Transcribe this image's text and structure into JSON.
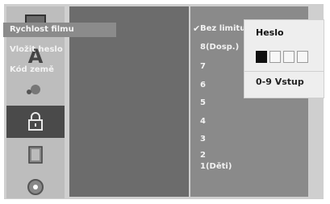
{
  "menu": {
    "items": [
      {
        "label": "Rychlost filmu",
        "selected": true
      },
      {
        "label": "Vložit heslo",
        "selected": false
      },
      {
        "label": "Kód země",
        "selected": false
      }
    ]
  },
  "options": {
    "items": [
      "Bez limitu",
      "8(Dosp.)",
      "7",
      "6",
      "5",
      "4",
      "3",
      "2",
      "1(Děti)"
    ],
    "checked_index": 0
  },
  "popup": {
    "title": "Heslo",
    "pin_count": 4,
    "filled": 1,
    "footer": "0-9 Vstup"
  },
  "sidebar": {
    "icons": [
      "tv-icon",
      "letter-a-icon",
      "audio-icon",
      "lock-icon",
      "film-icon",
      "disc-icon"
    ],
    "active_index": 3
  },
  "colors": {
    "menu_bg": "#6c6c6c",
    "options_bg": "#8a8a8a",
    "popup_bg": "#eeeeee",
    "active_icon_bg": "#4a4a4a"
  }
}
